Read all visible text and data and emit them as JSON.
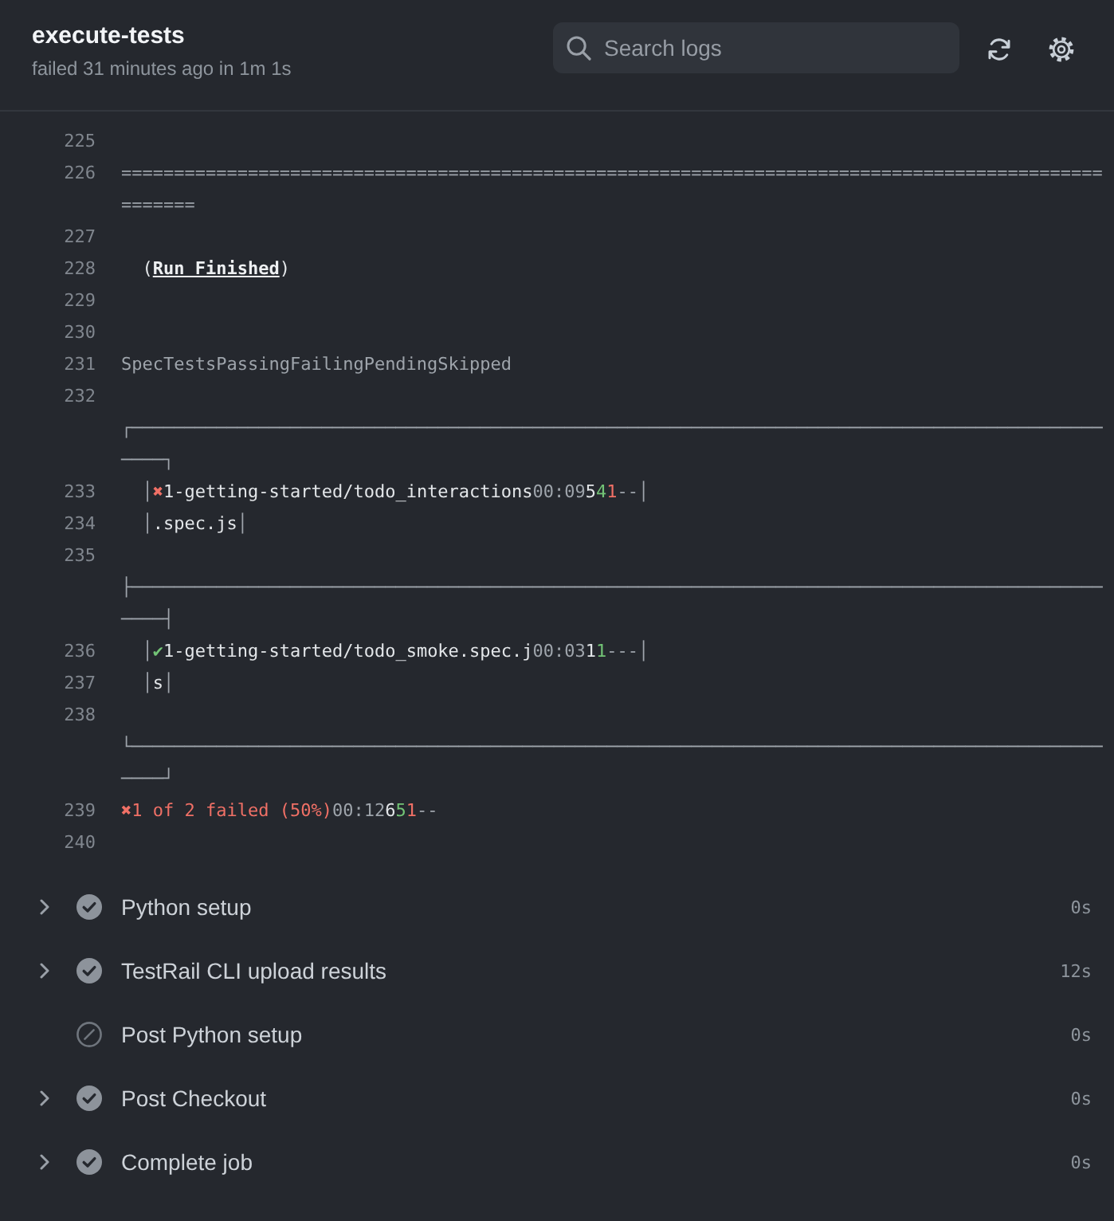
{
  "job": {
    "title": "execute-tests",
    "subtitle": "failed 31 minutes ago in 1m 1s"
  },
  "search": {
    "placeholder": "Search logs"
  },
  "log": [
    {
      "number": "225"
    },
    {
      "number": "226",
      "segments": [
        {
          "text": "====================================================================================================",
          "kind": "muted"
        }
      ]
    },
    {
      "number": "227"
    },
    {
      "number": "228",
      "segments": [
        {
          "text": "  (",
          "kind": "plain"
        },
        {
          "text": "Run Finished",
          "kind": "strong"
        },
        {
          "text": ")",
          "kind": "plain"
        }
      ]
    },
    {
      "number": "229"
    },
    {
      "number": "230"
    },
    {
      "number": "231",
      "segments": [
        {
          "text": "SpecTestsPassingFailingPendingSkipped",
          "kind": "muted"
        }
      ]
    },
    {
      "number": "232"
    },
    {
      "segments": [
        {
          "text": "┌────────────────────────────────────────────────────────────────────────────────────────────────┐",
          "kind": "muted"
        }
      ]
    },
    {
      "number": "233",
      "segments": [
        {
          "text": "  │",
          "kind": "muted"
        },
        {
          "text": "✖",
          "kind": "fail"
        },
        {
          "text": "1-getting-started/todo_interactions",
          "kind": "plain"
        },
        {
          "text": "00:09",
          "kind": "muted"
        },
        {
          "text": "5",
          "kind": "plain"
        },
        {
          "text": "4",
          "kind": "pass"
        },
        {
          "text": "1",
          "kind": "fail"
        },
        {
          "text": "--│",
          "kind": "muted"
        }
      ]
    },
    {
      "number": "234",
      "segments": [
        {
          "text": "  │",
          "kind": "muted"
        },
        {
          "text": ".spec.js",
          "kind": "plain"
        },
        {
          "text": "│",
          "kind": "muted"
        }
      ]
    },
    {
      "number": "235"
    },
    {
      "segments": [
        {
          "text": "├────────────────────────────────────────────────────────────────────────────────────────────────┤",
          "kind": "muted"
        }
      ]
    },
    {
      "number": "236",
      "segments": [
        {
          "text": "  │",
          "kind": "muted"
        },
        {
          "text": "✔",
          "kind": "pass"
        },
        {
          "text": "1-getting-started/todo_smoke.spec.j",
          "kind": "plain"
        },
        {
          "text": "00:03",
          "kind": "muted"
        },
        {
          "text": "1",
          "kind": "plain"
        },
        {
          "text": "1",
          "kind": "pass"
        },
        {
          "text": "---│",
          "kind": "muted"
        }
      ]
    },
    {
      "number": "237",
      "segments": [
        {
          "text": "  │",
          "kind": "muted"
        },
        {
          "text": "s",
          "kind": "plain"
        },
        {
          "text": "│",
          "kind": "muted"
        }
      ]
    },
    {
      "number": "238"
    },
    {
      "segments": [
        {
          "text": "└────────────────────────────────────────────────────────────────────────────────────────────────┘",
          "kind": "muted"
        }
      ]
    },
    {
      "number": "239",
      "segments": [
        {
          "text": "✖1 of 2 failed (50%)",
          "kind": "fail"
        },
        {
          "text": "00:12",
          "kind": "muted"
        },
        {
          "text": "6",
          "kind": "plain"
        },
        {
          "text": "5",
          "kind": "pass"
        },
        {
          "text": "1",
          "kind": "fail"
        },
        {
          "text": "--",
          "kind": "muted"
        }
      ]
    },
    {
      "number": "240"
    }
  ],
  "steps": [
    {
      "name": "Python setup",
      "duration": "0s",
      "kind": "success",
      "expandable": true
    },
    {
      "name": "TestRail CLI upload results",
      "duration": "12s",
      "kind": "success",
      "expandable": true
    },
    {
      "name": "Post Python setup",
      "duration": "0s",
      "kind": "skipped",
      "expandable": false
    },
    {
      "name": "Post Checkout",
      "duration": "0s",
      "kind": "success",
      "expandable": true
    },
    {
      "name": "Complete job",
      "duration": "0s",
      "kind": "success",
      "expandable": true
    }
  ]
}
